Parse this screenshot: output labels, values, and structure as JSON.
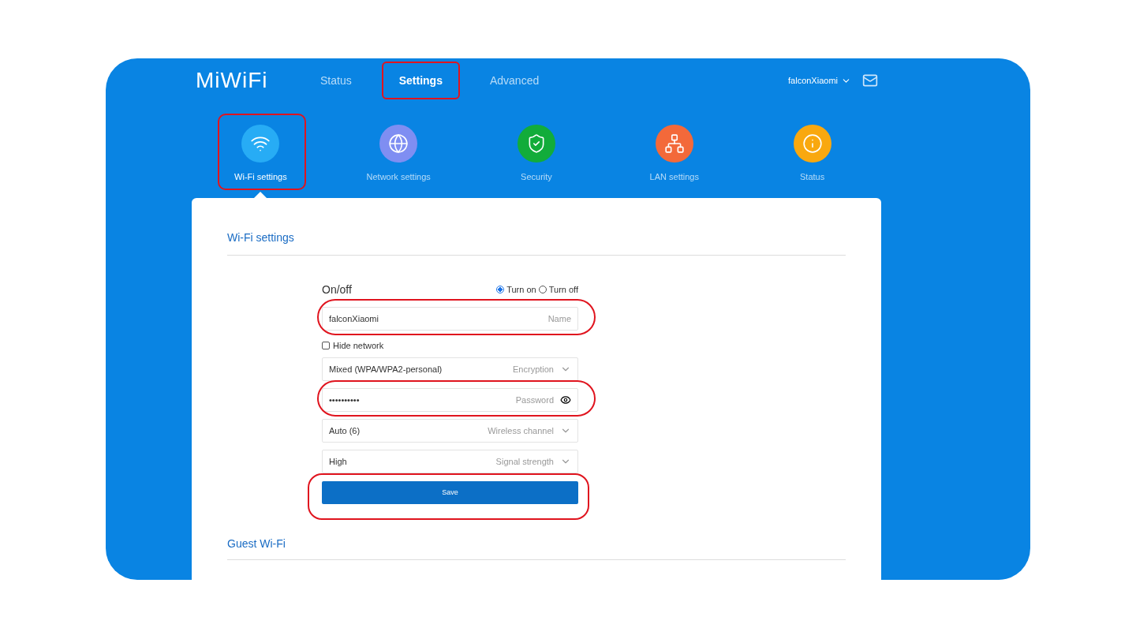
{
  "header": {
    "logo": "MiWiFi",
    "tabs": [
      {
        "label": "Status",
        "selected": false,
        "annotated": false
      },
      {
        "label": "Settings",
        "selected": true,
        "annotated": true
      },
      {
        "label": "Advanced",
        "selected": false,
        "annotated": false
      }
    ],
    "user": "falconXiaomi"
  },
  "categories": [
    {
      "kind": "wifi",
      "label": "Wi-Fi settings",
      "color": "#27acf5",
      "selected": true,
      "annotated": true
    },
    {
      "kind": "globe",
      "label": "Network settings",
      "color": "#7f8ef2",
      "selected": false,
      "annotated": false
    },
    {
      "kind": "shield",
      "label": "Security",
      "color": "#12ac3a",
      "selected": false,
      "annotated": false
    },
    {
      "kind": "lan",
      "label": "LAN settings",
      "color": "#f3693a",
      "selected": false,
      "annotated": false
    },
    {
      "kind": "info",
      "label": "Status",
      "color": "#f9a80f",
      "selected": false,
      "annotated": false
    }
  ],
  "wifi_settings": {
    "title": "Wi-Fi settings",
    "onoff": {
      "label": "On/off",
      "options": [
        {
          "label": "Turn on",
          "selected": true
        },
        {
          "label": "Turn off",
          "selected": false
        }
      ]
    },
    "fields": [
      {
        "kind": "text",
        "value": "falconXiaomi",
        "label": "Name",
        "annotated": true
      },
      {
        "kind": "checkbox",
        "text": "Hide network",
        "checked": false
      },
      {
        "kind": "select",
        "value": "Mixed (WPA/WPA2-personal)",
        "label": "Encryption",
        "annotated": false
      },
      {
        "kind": "password",
        "value": "••••••••••",
        "label": "Password",
        "annotated": true
      },
      {
        "kind": "select",
        "value": "Auto (6)",
        "label": "Wireless channel",
        "annotated": false
      },
      {
        "kind": "select",
        "value": "High",
        "label": "Signal strength",
        "annotated": false
      }
    ],
    "save": {
      "label": "Save",
      "annotated": true
    }
  },
  "guest_wifi": {
    "title": "Guest Wi-Fi"
  }
}
